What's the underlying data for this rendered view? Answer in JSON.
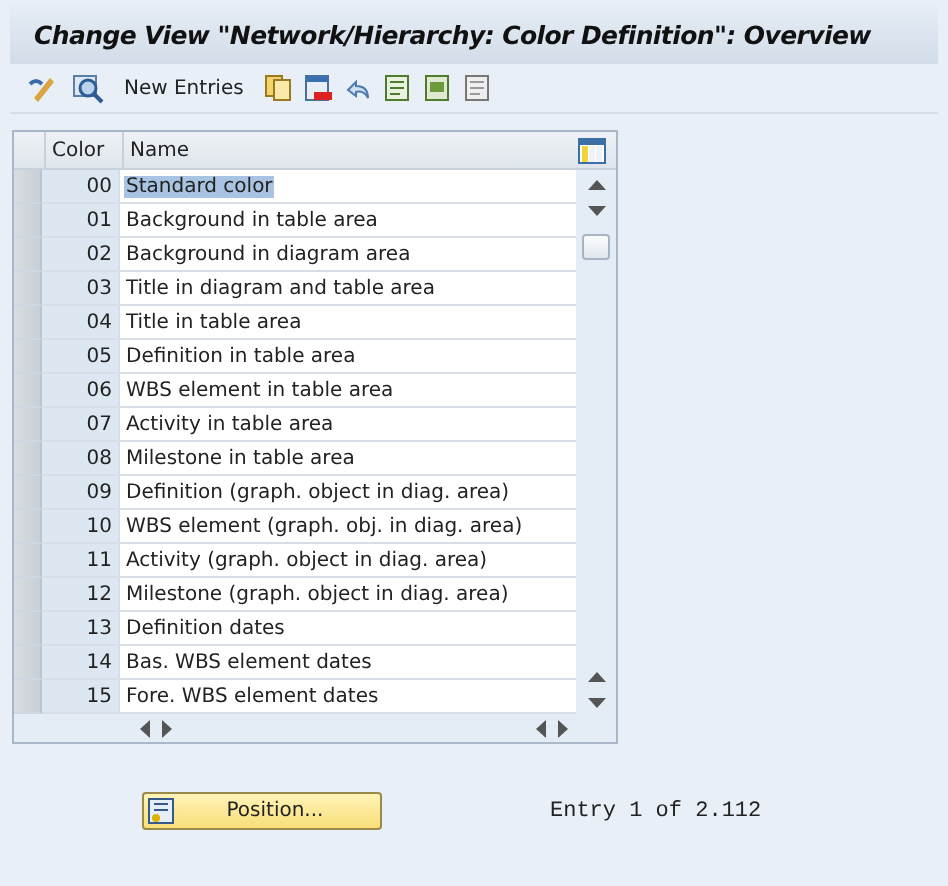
{
  "window": {
    "title": "Change View \"Network/Hierarchy: Color Definition\": Overview"
  },
  "toolbar": {
    "new_entries": "New Entries"
  },
  "table": {
    "columns": [
      "Color",
      "Name"
    ],
    "rows": [
      {
        "code": "00",
        "name": "Standard color",
        "selected": true
      },
      {
        "code": "01",
        "name": "Background in table area",
        "selected": false
      },
      {
        "code": "02",
        "name": "Background in diagram area",
        "selected": false
      },
      {
        "code": "03",
        "name": "Title in diagram and table area",
        "selected": false
      },
      {
        "code": "04",
        "name": "Title in table area",
        "selected": false
      },
      {
        "code": "05",
        "name": "Definition in table area",
        "selected": false
      },
      {
        "code": "06",
        "name": "WBS element in table area",
        "selected": false
      },
      {
        "code": "07",
        "name": "Activity in table area",
        "selected": false
      },
      {
        "code": "08",
        "name": "Milestone in table area",
        "selected": false
      },
      {
        "code": "09",
        "name": "Definition (graph. object in diag. area)",
        "selected": false
      },
      {
        "code": "10",
        "name": "WBS element (graph. obj. in diag. area)",
        "selected": false
      },
      {
        "code": "11",
        "name": "Activity (graph. object in diag. area)",
        "selected": false
      },
      {
        "code": "12",
        "name": "Milestone (graph. object in diag. area)",
        "selected": false
      },
      {
        "code": "13",
        "name": "Definition dates",
        "selected": false
      },
      {
        "code": "14",
        "name": "Bas. WBS element dates",
        "selected": false
      },
      {
        "code": "15",
        "name": "Fore. WBS element dates",
        "selected": false
      }
    ]
  },
  "footer": {
    "position_button": "Position...",
    "entry_info": "Entry 1 of 2.112"
  }
}
